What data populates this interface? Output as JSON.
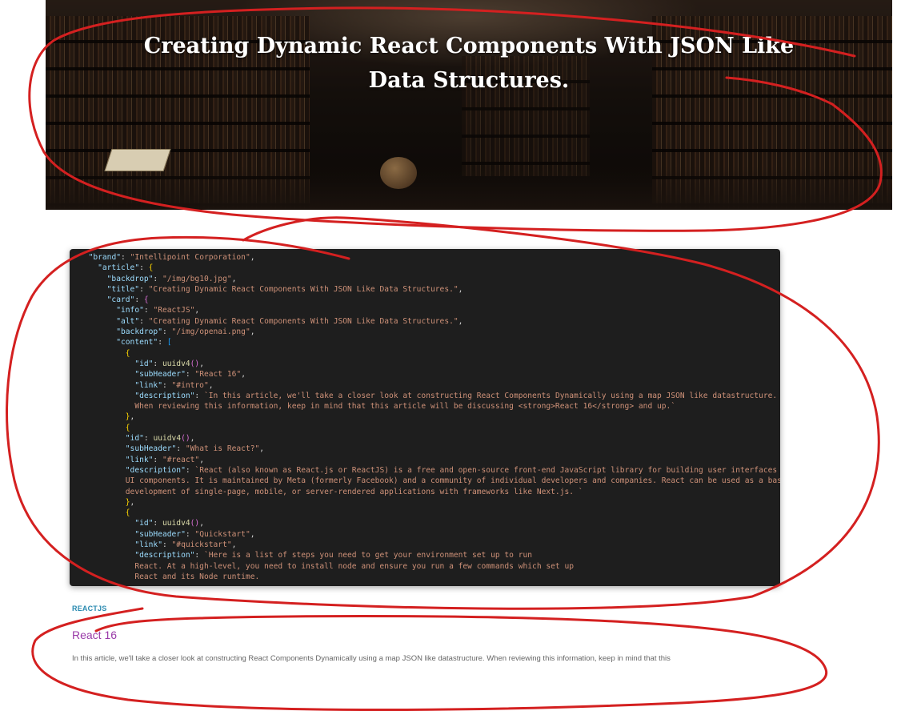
{
  "hero": {
    "title": "Creating Dynamic React Components With JSON Like Data Structures."
  },
  "code_lines": [
    {
      "indent": "  ",
      "parts": [
        {
          "c": "key",
          "t": "\"brand\""
        },
        {
          "c": "",
          "t": ": "
        },
        {
          "c": "str",
          "t": "\"Intellipoint Corporation\""
        },
        {
          "c": "",
          "t": ","
        }
      ]
    },
    {
      "indent": "    ",
      "parts": [
        {
          "c": "key",
          "t": "\"article\""
        },
        {
          "c": "",
          "t": ": "
        },
        {
          "c": "b1",
          "t": "{"
        }
      ]
    },
    {
      "indent": "      ",
      "parts": [
        {
          "c": "key",
          "t": "\"backdrop\""
        },
        {
          "c": "",
          "t": ": "
        },
        {
          "c": "str",
          "t": "\"/img/bg10.jpg\""
        },
        {
          "c": "",
          "t": ","
        }
      ]
    },
    {
      "indent": "      ",
      "parts": [
        {
          "c": "key",
          "t": "\"title\""
        },
        {
          "c": "",
          "t": ": "
        },
        {
          "c": "str",
          "t": "\"Creating Dynamic React Components With JSON Like Data Structures.\""
        },
        {
          "c": "",
          "t": ","
        }
      ]
    },
    {
      "indent": "      ",
      "parts": [
        {
          "c": "key",
          "t": "\"card\""
        },
        {
          "c": "",
          "t": ": "
        },
        {
          "c": "b2",
          "t": "{"
        }
      ]
    },
    {
      "indent": "        ",
      "parts": [
        {
          "c": "key",
          "t": "\"info\""
        },
        {
          "c": "",
          "t": ": "
        },
        {
          "c": "str",
          "t": "\"ReactJS\""
        },
        {
          "c": "",
          "t": ","
        }
      ]
    },
    {
      "indent": "        ",
      "parts": [
        {
          "c": "key",
          "t": "\"alt\""
        },
        {
          "c": "",
          "t": ": "
        },
        {
          "c": "str",
          "t": "\"Creating Dynamic React Components With JSON Like Data Structures.\""
        },
        {
          "c": "",
          "t": ","
        }
      ]
    },
    {
      "indent": "        ",
      "parts": [
        {
          "c": "key",
          "t": "\"backdrop\""
        },
        {
          "c": "",
          "t": ": "
        },
        {
          "c": "str",
          "t": "\"/img/openai.png\""
        },
        {
          "c": "",
          "t": ","
        }
      ]
    },
    {
      "indent": "        ",
      "parts": [
        {
          "c": "key",
          "t": "\"content\""
        },
        {
          "c": "",
          "t": ": "
        },
        {
          "c": "b3",
          "t": "["
        }
      ]
    },
    {
      "indent": "          ",
      "parts": [
        {
          "c": "b1",
          "t": "{"
        }
      ]
    },
    {
      "indent": "            ",
      "parts": [
        {
          "c": "key",
          "t": "\"id\""
        },
        {
          "c": "",
          "t": ": "
        },
        {
          "c": "fn",
          "t": "uuidv4"
        },
        {
          "c": "b2",
          "t": "()"
        },
        {
          "c": "",
          "t": ","
        }
      ]
    },
    {
      "indent": "            ",
      "parts": [
        {
          "c": "key",
          "t": "\"subHeader\""
        },
        {
          "c": "",
          "t": ": "
        },
        {
          "c": "str",
          "t": "\"React 16\""
        },
        {
          "c": "",
          "t": ","
        }
      ]
    },
    {
      "indent": "            ",
      "parts": [
        {
          "c": "key",
          "t": "\"link\""
        },
        {
          "c": "",
          "t": ": "
        },
        {
          "c": "str",
          "t": "\"#intro\""
        },
        {
          "c": "",
          "t": ","
        }
      ]
    },
    {
      "indent": "            ",
      "parts": [
        {
          "c": "key",
          "t": "\"description\""
        },
        {
          "c": "",
          "t": ": "
        },
        {
          "c": "str",
          "t": "`In this article, we'll take a closer look at constructing React Components Dynamically using a map JSON like datastructure."
        }
      ]
    },
    {
      "indent": "            ",
      "parts": [
        {
          "c": "str",
          "t": "When reviewing this information, keep in mind that this article will be discussing <strong>React 16</strong> and up.`"
        }
      ]
    },
    {
      "indent": "          ",
      "parts": [
        {
          "c": "b1",
          "t": "}"
        },
        {
          "c": "",
          "t": ","
        }
      ]
    },
    {
      "indent": "          ",
      "parts": [
        {
          "c": "b1",
          "t": "{"
        }
      ]
    },
    {
      "indent": "          ",
      "parts": [
        {
          "c": "key",
          "t": "\"id\""
        },
        {
          "c": "",
          "t": ": "
        },
        {
          "c": "fn",
          "t": "uuidv4"
        },
        {
          "c": "b2",
          "t": "()"
        },
        {
          "c": "",
          "t": ","
        }
      ]
    },
    {
      "indent": "          ",
      "parts": [
        {
          "c": "key",
          "t": "\"subHeader\""
        },
        {
          "c": "",
          "t": ": "
        },
        {
          "c": "str",
          "t": "\"What is React?\""
        },
        {
          "c": "",
          "t": ","
        }
      ]
    },
    {
      "indent": "          ",
      "parts": [
        {
          "c": "key",
          "t": "\"link\""
        },
        {
          "c": "",
          "t": ": "
        },
        {
          "c": "str",
          "t": "\"#react\""
        },
        {
          "c": "",
          "t": ","
        }
      ]
    },
    {
      "indent": "          ",
      "parts": [
        {
          "c": "key",
          "t": "\"description\""
        },
        {
          "c": "",
          "t": ": "
        },
        {
          "c": "str",
          "t": "`React (also known as React.js or ReactJS) is a free and open-source front-end JavaScript library for building user interfaces based on"
        }
      ]
    },
    {
      "indent": "          ",
      "parts": [
        {
          "c": "str",
          "t": "UI components. It is maintained by Meta (formerly Facebook) and a community of individual developers and companies. React can be used as a base in the"
        }
      ]
    },
    {
      "indent": "          ",
      "parts": [
        {
          "c": "str",
          "t": "development of single-page, mobile, or server-rendered applications with frameworks like Next.js. `"
        }
      ]
    },
    {
      "indent": "          ",
      "parts": [
        {
          "c": "b1",
          "t": "}"
        },
        {
          "c": "",
          "t": ","
        }
      ]
    },
    {
      "indent": "          ",
      "parts": [
        {
          "c": "b1",
          "t": "{"
        }
      ]
    },
    {
      "indent": "            ",
      "parts": [
        {
          "c": "key",
          "t": "\"id\""
        },
        {
          "c": "",
          "t": ": "
        },
        {
          "c": "fn",
          "t": "uuidv4"
        },
        {
          "c": "b2",
          "t": "()"
        },
        {
          "c": "",
          "t": ","
        }
      ]
    },
    {
      "indent": "            ",
      "parts": [
        {
          "c": "key",
          "t": "\"subHeader\""
        },
        {
          "c": "",
          "t": ": "
        },
        {
          "c": "str",
          "t": "\"Quickstart\""
        },
        {
          "c": "",
          "t": ","
        }
      ]
    },
    {
      "indent": "            ",
      "parts": [
        {
          "c": "key",
          "t": "\"link\""
        },
        {
          "c": "",
          "t": ": "
        },
        {
          "c": "str",
          "t": "\"#quickstart\""
        },
        {
          "c": "",
          "t": ","
        }
      ]
    },
    {
      "indent": "            ",
      "parts": [
        {
          "c": "key",
          "t": "\"description\""
        },
        {
          "c": "",
          "t": ": "
        },
        {
          "c": "str",
          "t": "`Here is a list of steps you need to get your environment set up to run"
        }
      ]
    },
    {
      "indent": "            ",
      "parts": [
        {
          "c": "str",
          "t": "React. At a high-level, you need to install node and ensure you run a few commands which set up"
        }
      ]
    },
    {
      "indent": "            ",
      "parts": [
        {
          "c": "str",
          "t": "React and its Node runtime."
        }
      ]
    }
  ],
  "card": {
    "tag": "REACTJS",
    "subheader": "React 16",
    "description": "In this article, we'll take a closer look at constructing React Components Dynamically using a map JSON like datastructure. When reviewing this information, keep in mind that this"
  },
  "colors": {
    "annotation": "#d42020",
    "tag": "#2a8ab0",
    "subheader": "#9a3aa8",
    "code_bg": "#1e1e1e"
  }
}
